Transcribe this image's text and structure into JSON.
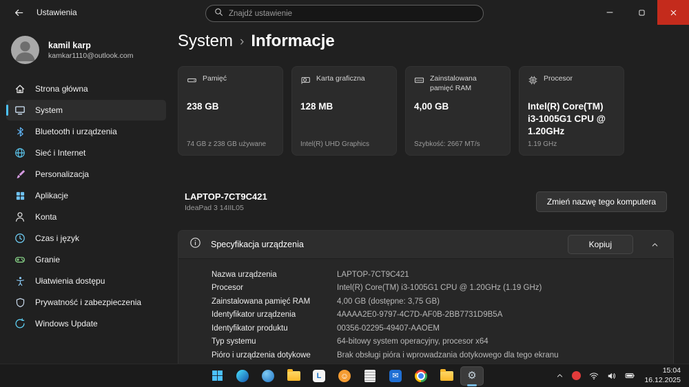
{
  "window": {
    "title": "Ustawienia",
    "search_placeholder": "Znajdź ustawienie"
  },
  "sidebar": {
    "user": {
      "name": "kamil karp",
      "email": "kamkar1110@outlook.com"
    },
    "items": [
      {
        "label": "Strona główna",
        "icon": "home-icon",
        "selected": false
      },
      {
        "label": "System",
        "icon": "system-icon",
        "selected": true
      },
      {
        "label": "Bluetooth i urządzenia",
        "icon": "bluetooth-icon",
        "selected": false
      },
      {
        "label": "Sieć i Internet",
        "icon": "network-globe-icon",
        "selected": false
      },
      {
        "label": "Personalizacja",
        "icon": "paintbrush-icon",
        "selected": false
      },
      {
        "label": "Aplikacje",
        "icon": "apps-grid-icon",
        "selected": false
      },
      {
        "label": "Konta",
        "icon": "person-icon",
        "selected": false
      },
      {
        "label": "Czas i język",
        "icon": "clock-icon",
        "selected": false
      },
      {
        "label": "Granie",
        "icon": "gamepad-icon",
        "selected": false
      },
      {
        "label": "Ułatwienia dostępu",
        "icon": "accessibility-icon",
        "selected": false
      },
      {
        "label": "Prywatność i zabezpieczenia",
        "icon": "shield-icon",
        "selected": false
      },
      {
        "label": "Windows Update",
        "icon": "update-arrows-icon",
        "selected": false
      }
    ]
  },
  "main": {
    "breadcrumb": {
      "parent": "System",
      "separator": "›",
      "current": "Informacje"
    },
    "cards": [
      {
        "title": "Pamięć",
        "value": "238 GB",
        "subtitle": "74 GB z 238 GB używane",
        "icon": "storage-icon"
      },
      {
        "title": "Karta graficzna",
        "value": "128 MB",
        "subtitle": "Intel(R) UHD Graphics",
        "icon": "gpu-icon"
      },
      {
        "title": "Zainstalowana pamięć RAM",
        "value": "4,00 GB",
        "subtitle": "Szybkość: 2667 MT/s",
        "icon": "ram-icon"
      },
      {
        "title": "Procesor",
        "value": "Intel(R) Core(TM) i3-1005G1 CPU @ 1.20GHz",
        "subtitle": "1.19 GHz",
        "icon": "cpu-icon"
      }
    ],
    "device": {
      "name": "LAPTOP-7CT9C421",
      "model": "IdeaPad 3 14IIL05",
      "rename_button": "Zmień nazwę tego komputera"
    },
    "spec_section": {
      "title": "Specyfikacja urządzenia",
      "copy_button": "Kopiuj",
      "rows": [
        {
          "label": "Nazwa urządzenia",
          "value": "LAPTOP-7CT9C421"
        },
        {
          "label": "Procesor",
          "value": "Intel(R) Core(TM) i3-1005G1 CPU @ 1.20GHz (1.19 GHz)"
        },
        {
          "label": "Zainstalowana pamięć RAM",
          "value": "4,00 GB (dostępne: 3,75 GB)"
        },
        {
          "label": "Identyfikator urządzenia",
          "value": "4AAAA2E0-9797-4C7D-AF0B-2BB7731D9B5A"
        },
        {
          "label": "Identyfikator produktu",
          "value": "00356-02295-49407-AAOEM"
        },
        {
          "label": "Typ systemu",
          "value": "64-bitowy system operacyjny, procesor x64"
        },
        {
          "label": "Pióro i urządzenia dotykowe",
          "value": "Brak obsługi pióra i wprowadzania dotykowego dla tego ekranu"
        }
      ]
    }
  },
  "taskbar": {
    "time": "15:04",
    "date": "16.12.2025"
  },
  "icons": {
    "gear": "⚙",
    "smiley": "☺",
    "mail": "✉",
    "libre_letter": "L"
  },
  "accent_color": "#4cc2ff"
}
